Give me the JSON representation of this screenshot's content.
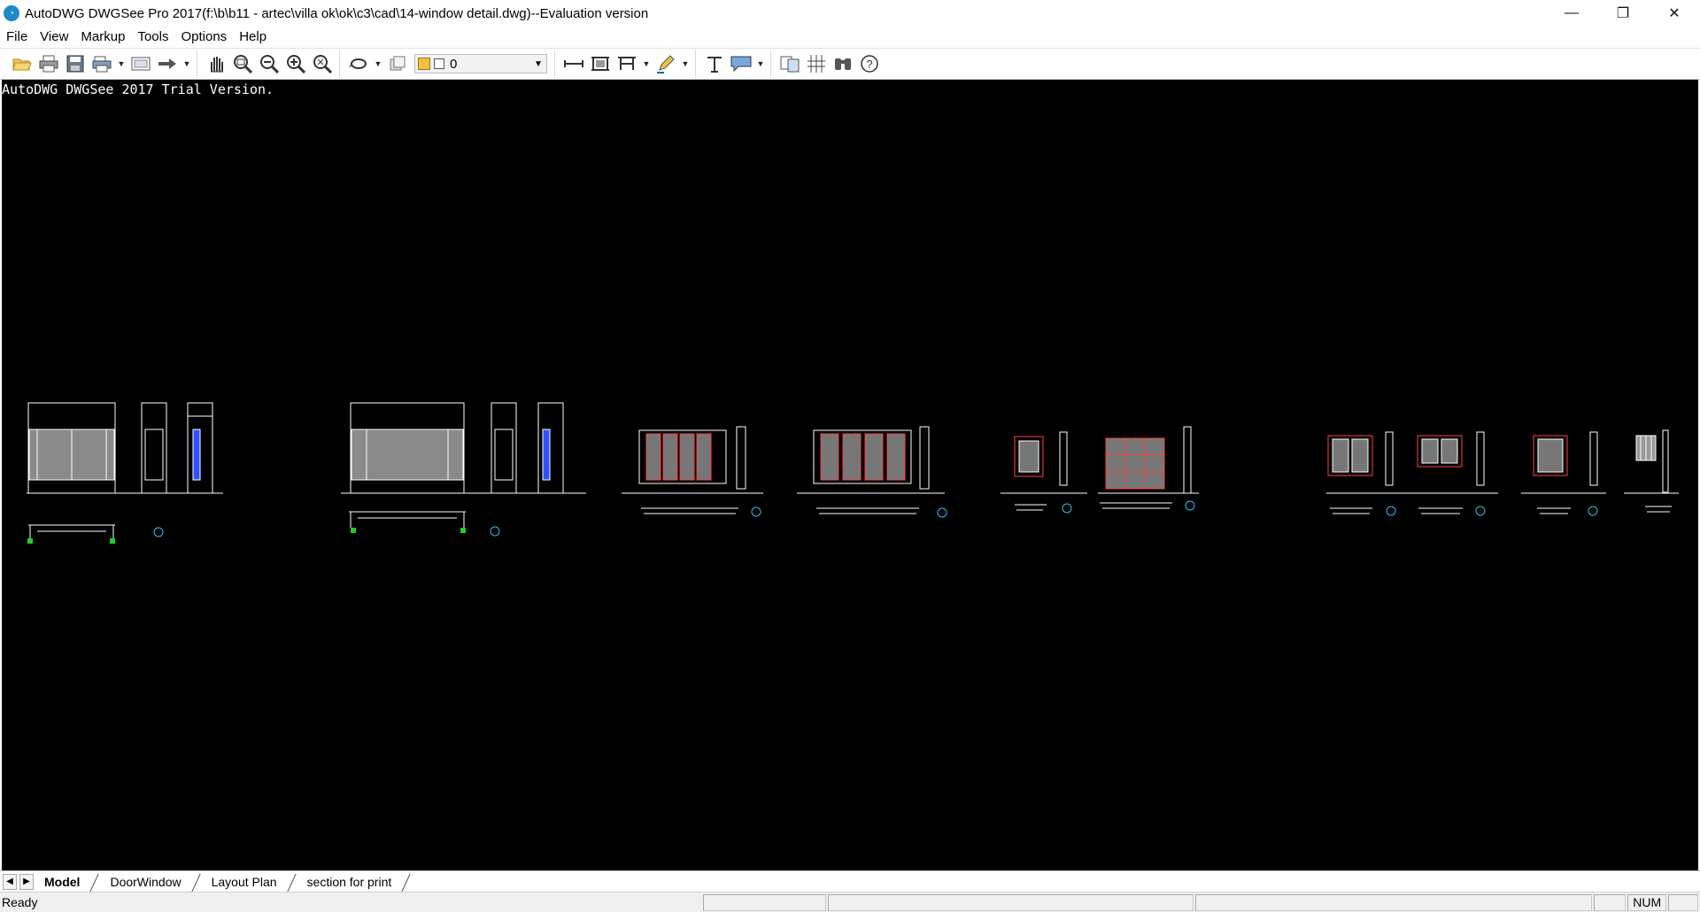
{
  "window": {
    "title": "AutoDWG DWGSee Pro 2017(f:\\b\\b11 - artec\\villa ok\\ok\\c3\\cad\\14-window detail.dwg)--Evaluation version",
    "app_icon": "dwgsee-app-icon",
    "minimize": "—",
    "restore": "❐",
    "close": "✕"
  },
  "menu": {
    "items": [
      "File",
      "View",
      "Markup",
      "Tools",
      "Options",
      "Help"
    ]
  },
  "toolbar": {
    "layer_value": "0",
    "icons": [
      "open-icon",
      "print-icon",
      "save-icon",
      "batch-print-icon",
      "page-setup-icon",
      "export-icon",
      "pan-icon",
      "zoom-window-icon",
      "zoom-out-icon",
      "zoom-in-icon",
      "zoom-extents-icon",
      "layer-manager-icon",
      "layer-icon",
      "measure-distance-icon",
      "measure-area-icon",
      "measure-align-icon",
      "markup-pen-icon",
      "text-icon",
      "callout-icon",
      "compare-icon",
      "hatch-icon",
      "find-icon",
      "help-icon"
    ]
  },
  "canvas": {
    "trial_text": "AutoDWG DWGSee 2017 Trial Version.",
    "background": "#000000"
  },
  "tabs": {
    "prev": "◀",
    "next": "▶",
    "items": [
      "Model",
      "DoorWindow",
      "Layout Plan",
      "section for print"
    ],
    "active": "Model"
  },
  "status": {
    "text": "Ready",
    "num": "NUM"
  },
  "colors": {
    "drawing_line": "#ffffff",
    "red_frame": "#ff4040",
    "gray_fill": "#8a8a8a",
    "blue_detail": "#3050ff",
    "green_marker": "#22cc22",
    "cyan_tag": "#22c6e8"
  }
}
